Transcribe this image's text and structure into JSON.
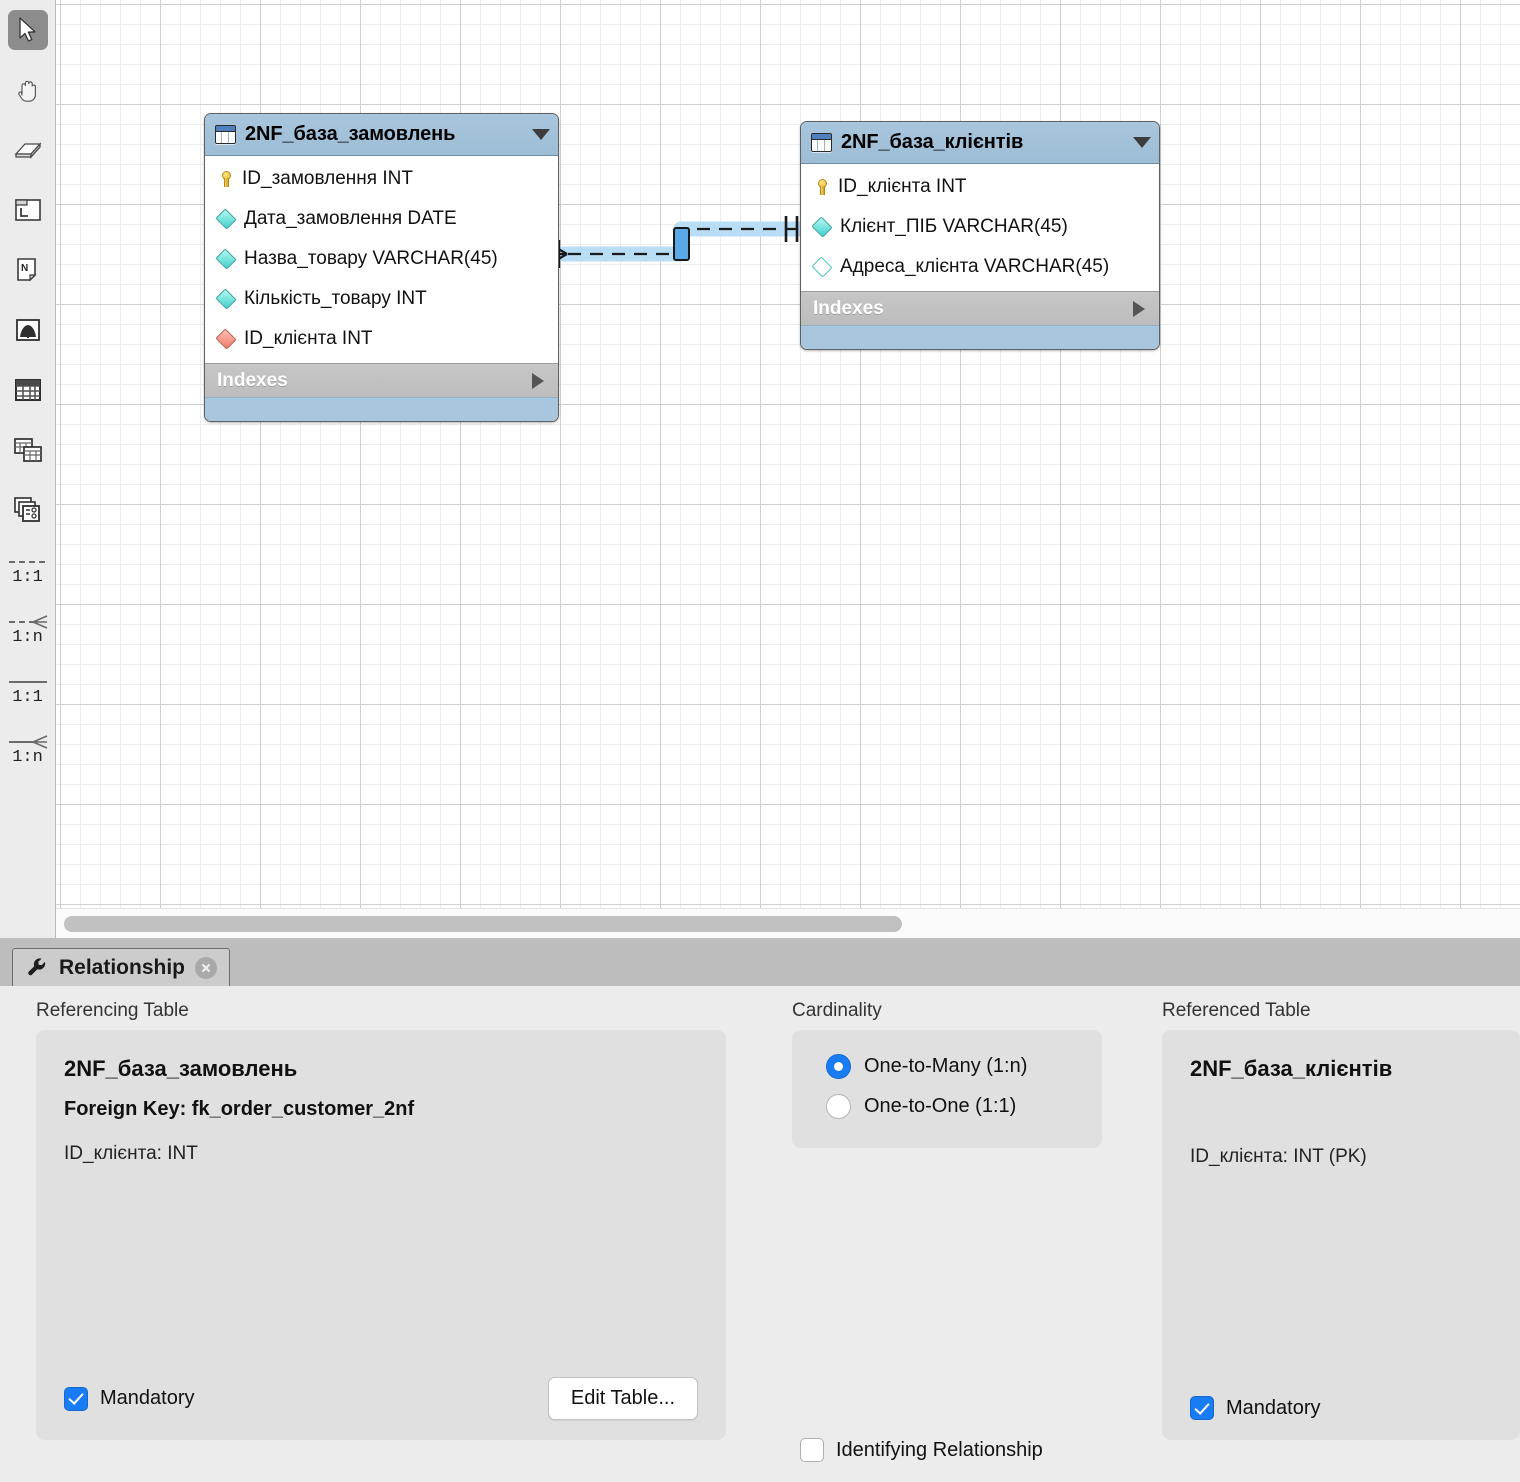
{
  "palette": {
    "tools": [
      {
        "name": "pointer-tool",
        "icon": "pointer-icon",
        "selected": true
      },
      {
        "name": "hand-tool",
        "icon": "hand-icon",
        "selected": false
      },
      {
        "name": "eraser-tool",
        "icon": "eraser-icon",
        "selected": false
      },
      {
        "name": "layer-tool",
        "icon": "layer-icon",
        "selected": false
      },
      {
        "name": "note-tool",
        "icon": "note-icon",
        "selected": false
      },
      {
        "name": "image-tool",
        "icon": "image-icon",
        "selected": false
      },
      {
        "name": "new-table-tool",
        "icon": "table-icon",
        "selected": false
      },
      {
        "name": "new-view-tool",
        "icon": "view-icon",
        "selected": false
      },
      {
        "name": "new-routine-group-tool",
        "icon": "routine-group-icon",
        "selected": false
      }
    ],
    "relationship_tools": [
      {
        "name": "relationship-1-1-non-identifying",
        "label": "1:1",
        "style": "dashed",
        "crow": false
      },
      {
        "name": "relationship-1-n-non-identifying",
        "label": "1:n",
        "style": "dashed",
        "crow": true
      },
      {
        "name": "relationship-1-1-identifying",
        "label": "1:1",
        "style": "solid",
        "crow": false
      },
      {
        "name": "relationship-1-n-identifying",
        "label": "1:n",
        "style": "solid",
        "crow": true
      }
    ]
  },
  "canvas": {
    "tables": [
      {
        "name": "2NF_база_замовлень",
        "indexes_label": "Indexes",
        "columns": [
          {
            "glyph": "primary-key-icon",
            "text": "ID_замовлення INT"
          },
          {
            "glyph": "column-icon",
            "text": "Дата_замовлення DATE"
          },
          {
            "glyph": "column-icon",
            "text": "Назва_товару VARCHAR(45)"
          },
          {
            "glyph": "column-icon",
            "text": "Кількість_товару INT"
          },
          {
            "glyph": "foreign-key-icon",
            "text": "ID_клієнта INT"
          }
        ]
      },
      {
        "name": "2NF_база_клієнтів",
        "indexes_label": "Indexes",
        "columns": [
          {
            "glyph": "primary-key-icon",
            "text": "ID_клієнта INT"
          },
          {
            "glyph": "column-icon",
            "text": "Клієнт_ПІБ VARCHAR(45)"
          },
          {
            "glyph": "nullable-column-icon",
            "text": "Адреса_клієнта VARCHAR(45)"
          }
        ]
      }
    ],
    "connector": {
      "name": "relationship-connector",
      "style": "dashed",
      "cardinality": "1:n",
      "selected": true
    }
  },
  "dock": {
    "tab_label": "Relationship",
    "referencing": {
      "section_label": "Referencing Table",
      "table_name": "2NF_база_замовлень",
      "foreign_key": "Foreign Key: fk_order_customer_2nf",
      "column": "ID_клієнта: INT",
      "mandatory_label": "Mandatory",
      "mandatory_checked": true,
      "edit_table_label": "Edit Table..."
    },
    "cardinality": {
      "section_label": "Cardinality",
      "options": [
        {
          "label": "One-to-Many (1:n)",
          "selected": true
        },
        {
          "label": "One-to-One (1:1)",
          "selected": false
        }
      ],
      "identifying_label": "Identifying Relationship",
      "identifying_checked": false
    },
    "referenced": {
      "section_label": "Referenced Table",
      "table_name": "2NF_база_клієнтів",
      "column": "ID_клієнта: INT (PK)",
      "mandatory_label": "Mandatory",
      "mandatory_checked": true
    }
  },
  "colors": {
    "table_header": "#a8c6dd",
    "indexes_bar": "#bdbdbd",
    "accent_blue": "#1a7cf5",
    "connector_selected": "#b8ddf5",
    "panel_box": "#e0e0e0"
  }
}
